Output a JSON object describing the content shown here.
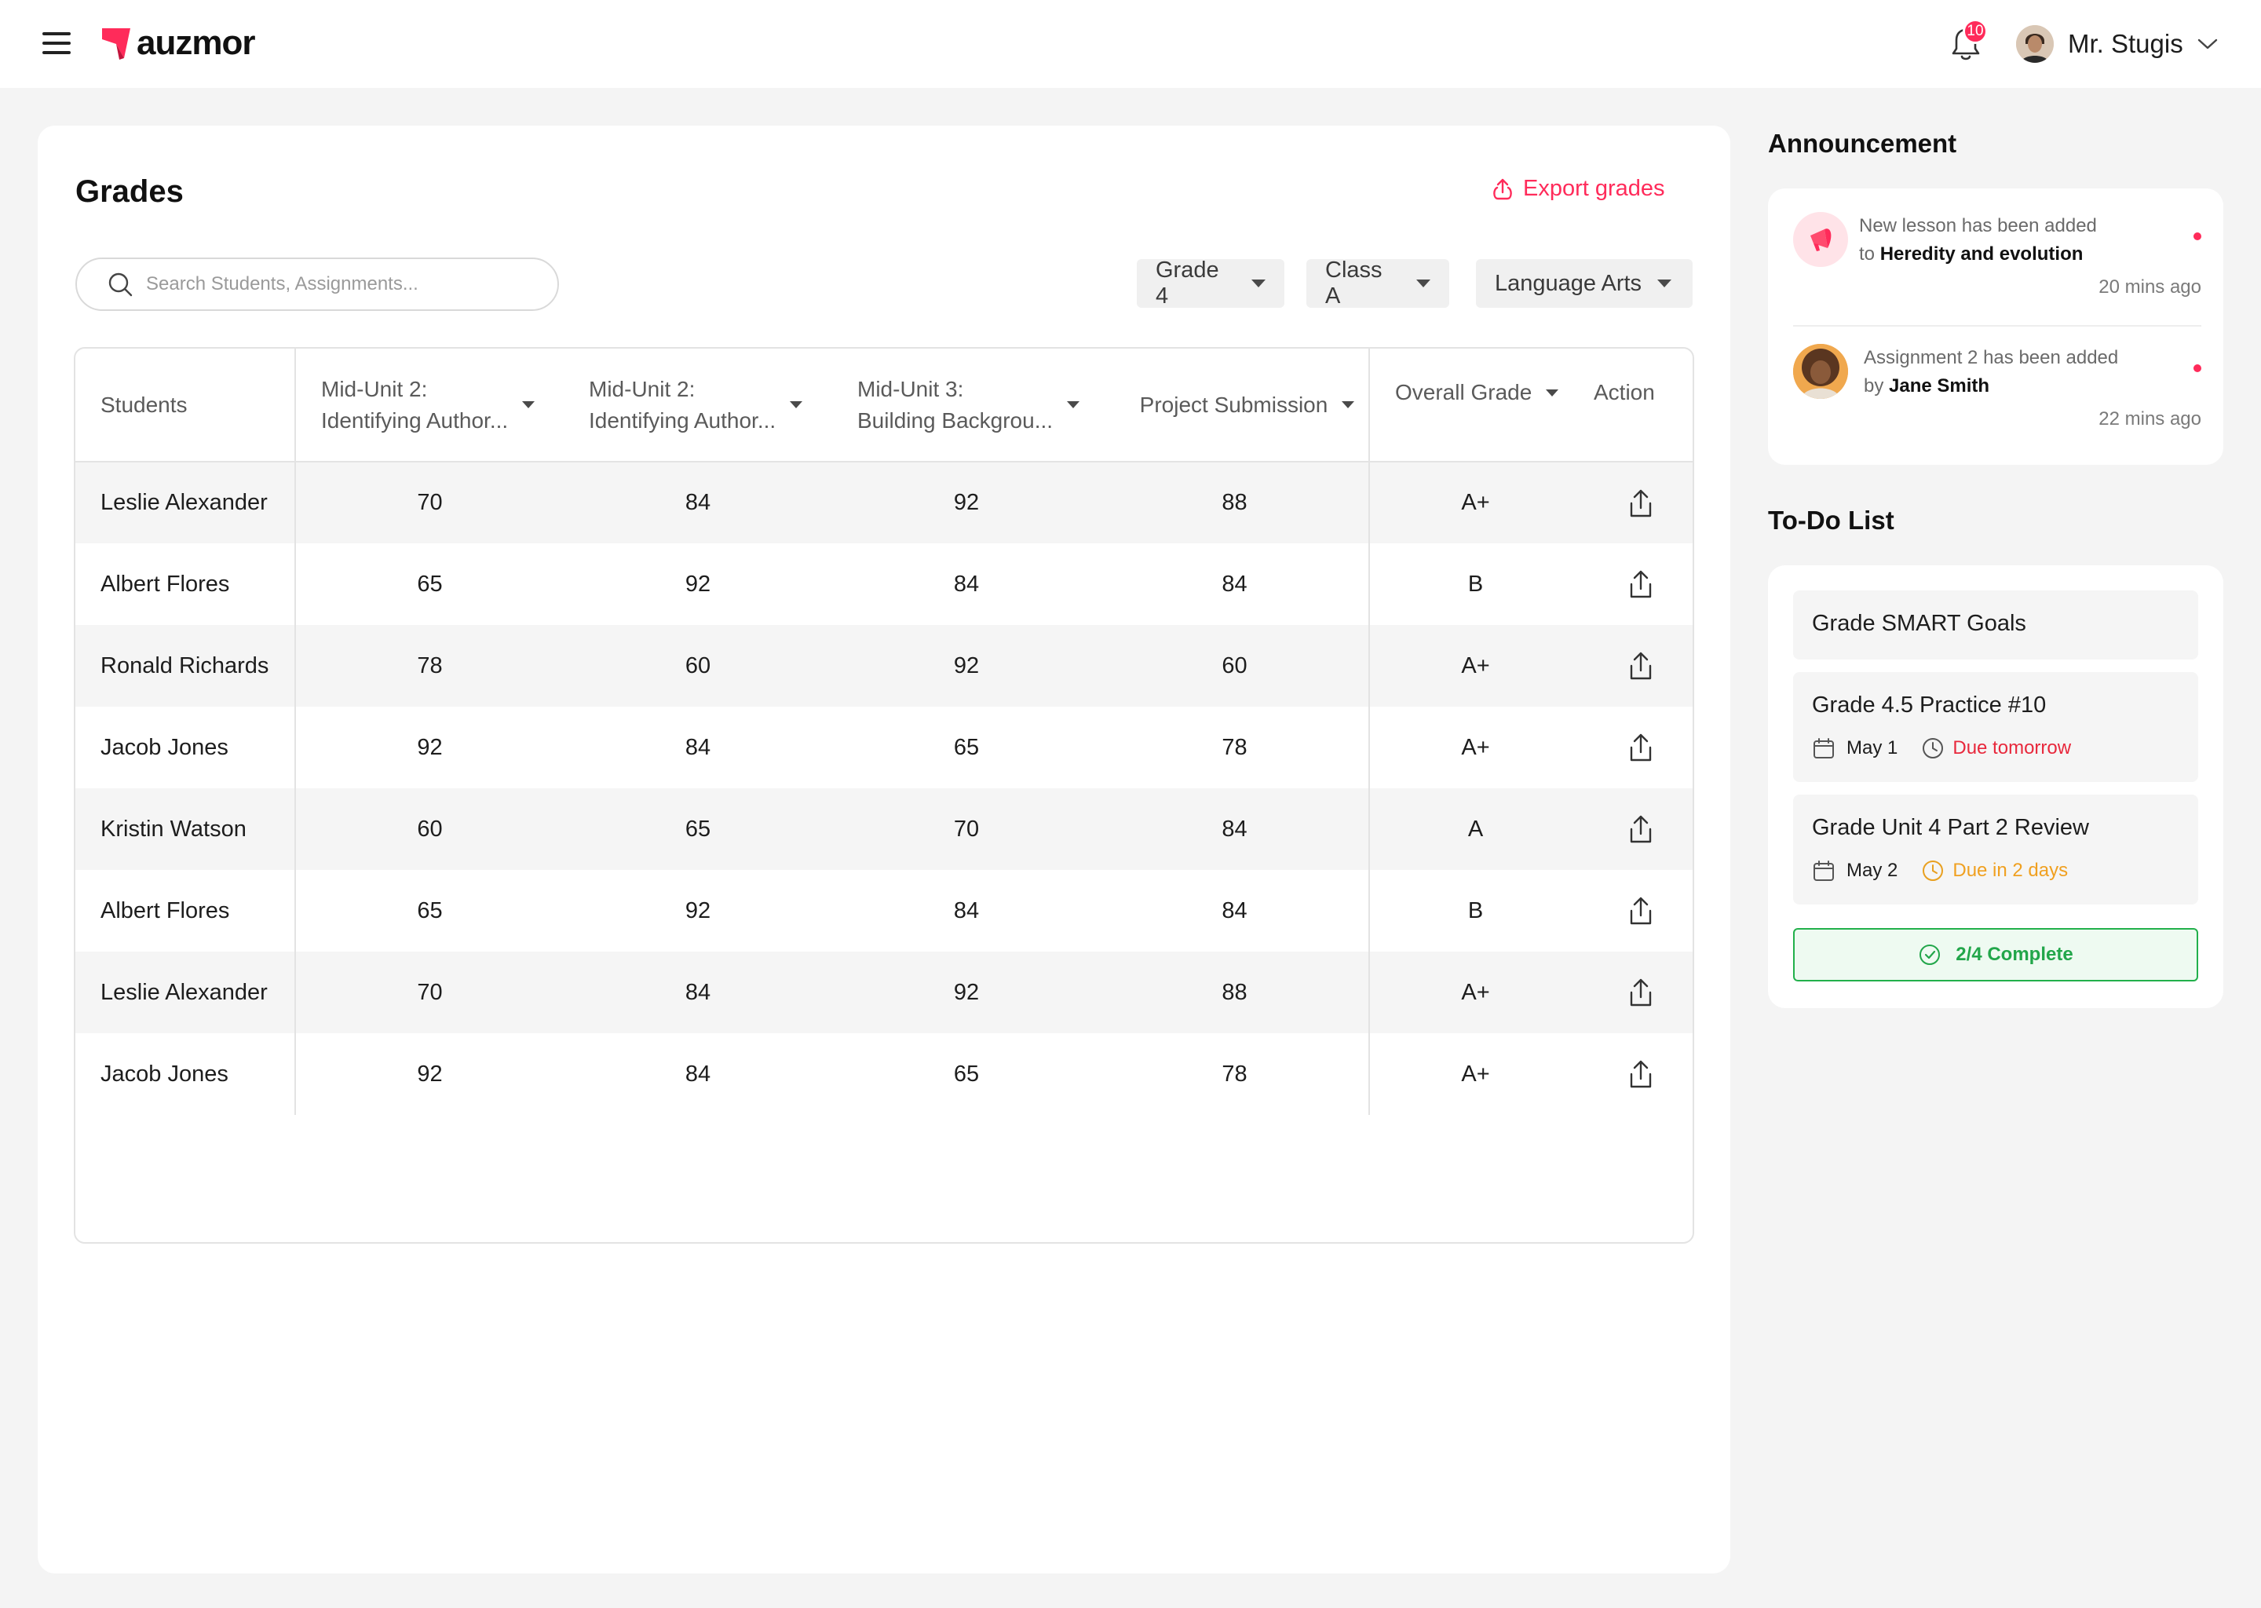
{
  "header": {
    "logo_text": "auzmor",
    "notification_count": "10",
    "user_name": "Mr. Stugis"
  },
  "grades": {
    "title": "Grades",
    "export_label": "Export grades",
    "search_placeholder": "Search Students, Assignments...",
    "filters": {
      "grade": "Grade 4",
      "class": "Class A",
      "subject": "Language Arts"
    },
    "columns": {
      "students": "Students",
      "a1_line1": "Mid-Unit 2:",
      "a1_line2": "Identifying Author...",
      "a2_line1": "Mid-Unit 2:",
      "a2_line2": "Identifying Author...",
      "a3_line1": "Mid-Unit 3:",
      "a3_line2": "Building Backgrou...",
      "project": "Project Submission",
      "overall": "Overall Grade",
      "action": "Action"
    },
    "rows": [
      {
        "name": "Leslie Alexander",
        "a1": "70",
        "a2": "84",
        "a3": "92",
        "project": "88",
        "overall": "A+"
      },
      {
        "name": "Albert Flores",
        "a1": "65",
        "a2": "92",
        "a3": "84",
        "project": "84",
        "overall": "B"
      },
      {
        "name": "Ronald Richards",
        "a1": "78",
        "a2": "60",
        "a3": "92",
        "project": "60",
        "overall": "A+"
      },
      {
        "name": "Jacob Jones",
        "a1": "92",
        "a2": "84",
        "a3": "65",
        "project": "78",
        "overall": "A+"
      },
      {
        "name": "Kristin Watson",
        "a1": "60",
        "a2": "65",
        "a3": "70",
        "project": "84",
        "overall": "A"
      },
      {
        "name": "Albert Flores",
        "a1": "65",
        "a2": "92",
        "a3": "84",
        "project": "84",
        "overall": "B"
      },
      {
        "name": "Leslie Alexander",
        "a1": "70",
        "a2": "84",
        "a3": "92",
        "project": "88",
        "overall": "A+"
      },
      {
        "name": "Jacob Jones",
        "a1": "92",
        "a2": "84",
        "a3": "65",
        "project": "78",
        "overall": "A+"
      }
    ]
  },
  "announcement": {
    "title": "Announcement",
    "items": [
      {
        "line1": "New lesson has been added",
        "prefix": "to",
        "subject": "Heredity and evolution",
        "time": "20 mins ago",
        "icon": "megaphone-icon"
      },
      {
        "line1": "Assignment 2 has been added",
        "prefix": "by",
        "subject": "Jane Smith",
        "time": "22 mins ago",
        "icon": "avatar"
      }
    ]
  },
  "todo": {
    "title": "To-Do List",
    "items": [
      {
        "title": "Grade SMART Goals"
      },
      {
        "title": "Grade 4.5 Practice #10",
        "date": "May 1",
        "due": "Due tomorrow",
        "due_color": "#e8283c"
      },
      {
        "title": "Grade Unit 4 Part 2 Review",
        "date": "May 2",
        "due": "Due in 2 days",
        "due_color": "#f0a020"
      }
    ],
    "complete_label": "2/4 Complete"
  },
  "colors": {
    "accent": "#ff2b5a",
    "success": "#22b04b"
  }
}
